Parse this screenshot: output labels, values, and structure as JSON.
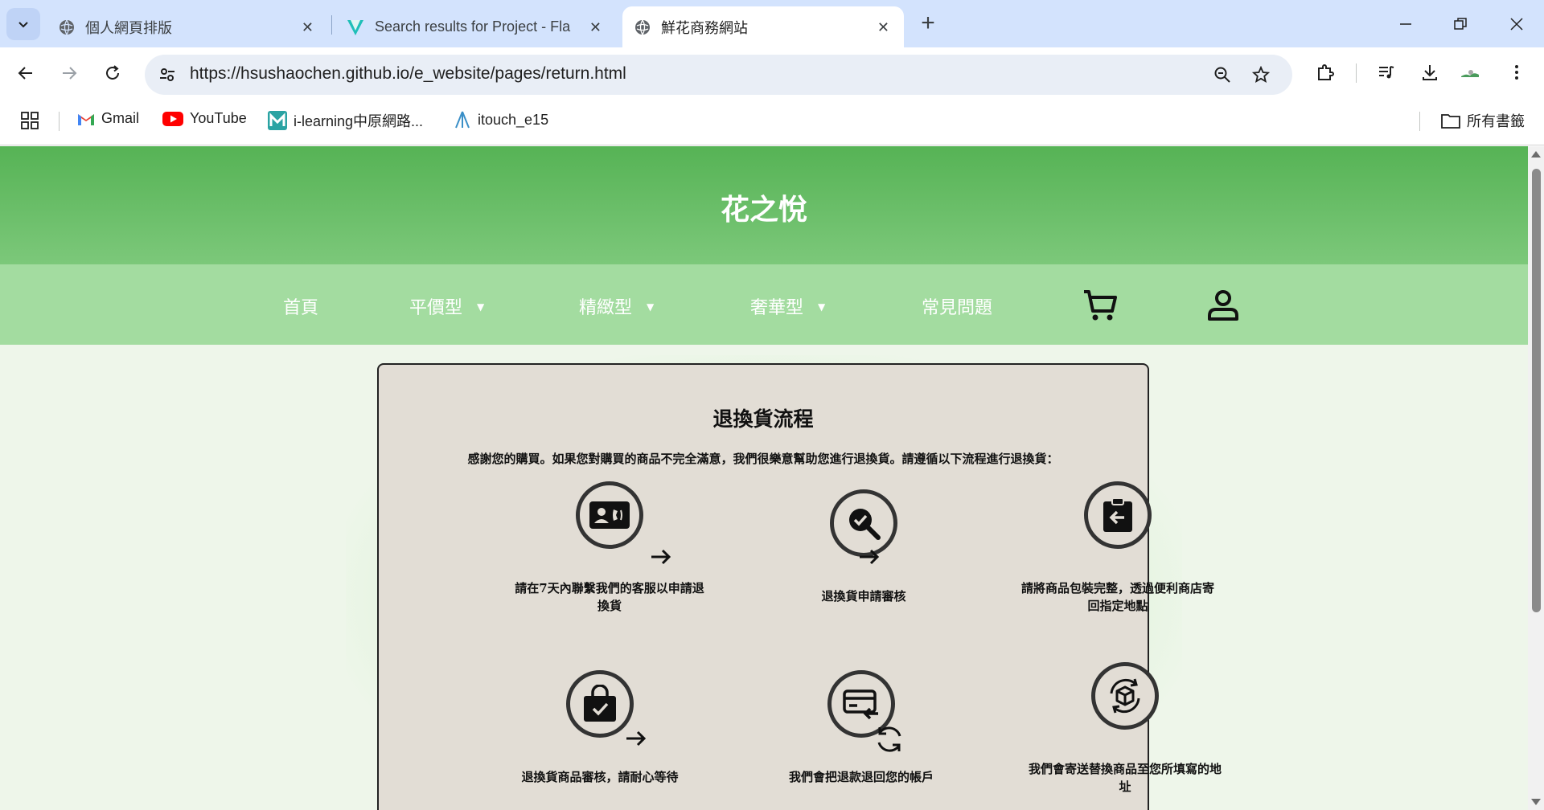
{
  "browser": {
    "tabs": [
      {
        "title": "個人網頁排版",
        "active": false
      },
      {
        "title": "Search results for Project - Fla",
        "active": false
      },
      {
        "title": "鮮花商務網站",
        "active": true
      }
    ],
    "address": "https://hsushaochen.github.io/e_website/pages/return.html",
    "bookmarks": [
      "Gmail",
      "YouTube",
      "i-learning中原網路...",
      "itouch_e15"
    ],
    "all_bookmarks": "所有書籤"
  },
  "site": {
    "title": "花之悅",
    "nav": {
      "home": "首頁",
      "affordable": "平價型",
      "refined": "精緻型",
      "luxury": "奢華型",
      "faq": "常見問題",
      "caret": "▼"
    }
  },
  "content": {
    "heading": "退換貨流程",
    "intro": "感謝您的購買。如果您對購買的商品不完全滿意，我們很樂意幫助您進行退換貨。請遵循以下流程進行退換貨：",
    "steps": [
      "請在7天內聯繫我們的客服以申請退換貨",
      "退換貨申請審核",
      "請將商品包裝完整，透過便利商店寄回指定地點",
      "退換貨商品審核，請耐心等待",
      "我們會把退款退回您的帳戶",
      "我們會寄送替換商品至您所填寫的地址"
    ]
  },
  "colors": {
    "header_green": "#56b355",
    "nav_green": "#a3dca0",
    "card_bg": "#e2ddd5",
    "page_bg": "#eef6ea"
  }
}
